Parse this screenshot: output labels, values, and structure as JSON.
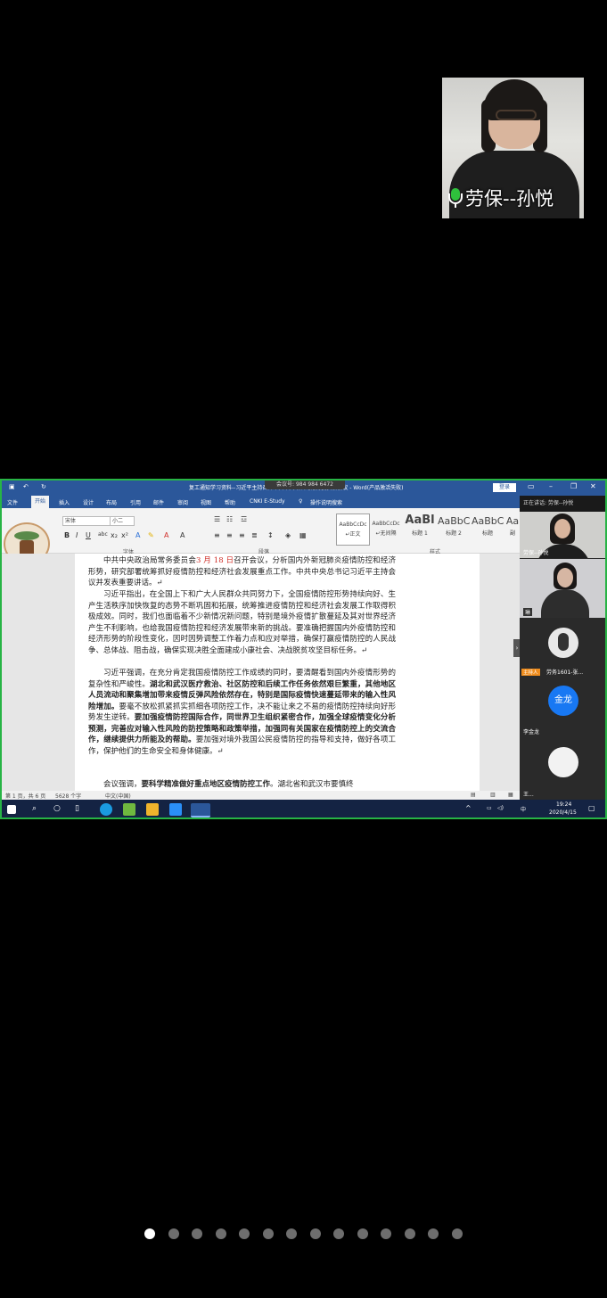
{
  "presenter": {
    "name": "劳保--孙悦"
  },
  "window": {
    "title": "复工通知学习资料--习近平主持召开中共中央政治局常务委员会会议 - Word(产品激活失败)",
    "meeting_code": "会议号: 984 984 6472",
    "login": "登录"
  },
  "ribbon": {
    "tabs": [
      "文件",
      "开始",
      "插入",
      "设计",
      "布局",
      "引用",
      "邮件",
      "审阅",
      "视图",
      "帮助",
      "CNKI E-Study",
      "操作说明搜索"
    ],
    "font_name": "宋体",
    "font_size": "小二",
    "groups": {
      "font": "字体",
      "paragraph": "段落",
      "styles": "样式"
    },
    "styles": [
      {
        "sample": "AaBbCcDc",
        "label": "↵正文"
      },
      {
        "sample": "AaBbCcDc",
        "label": "↵无间隔"
      },
      {
        "sample": "AaBl",
        "label": "标题 1"
      },
      {
        "sample": "AaBbC",
        "label": "标题 2"
      },
      {
        "sample": "AaBbC",
        "label": "标题"
      },
      {
        "sample": "Aa",
        "label": "副"
      }
    ]
  },
  "document": {
    "p1_a": "中共中央政治局常务委员会",
    "p1_date": "3 月 18 日",
    "p1_b": "召开会议，分析国内外新冠肺炎疫情防控和经济形势，研究部署统筹抓好疫情防控和经济社会发展重点工作。中共中央总书记习近平主持会议并发表重要讲话。↵",
    "p2": "习近平指出，在全国上下和广大人民群众共同努力下，全国疫情防控形势持续向好、生产生活秩序加快恢复的态势不断巩固和拓展，统筹推进疫情防控和经济社会发展工作取得积极成效。同时，我们也面临着不少新情况新问题，特别是境外疫情扩散蔓延及其对世界经济产生不利影响，也给我国疫情防控和经济发展带来新的挑战。要准确把握国内外疫情防控和经济形势的阶段性变化，因时因势调整工作着力点和应对举措，确保打赢疫情防控的人民战争、总体战、阻击战，确保实现决胜全面建成小康社会、决战脱贫攻坚目标任务。↵",
    "p3_a": "习近平强调，在充分肯定我国疫情防控工作成绩的同时，要清醒看到国内外疫情形势的复杂性和严峻性。",
    "p3_b": "湖北和武汉医疗救治、社区防控和后续工作任务依然艰巨繁重，其他地区人员流动和聚集增加带来疫情反弹风险依然存在，特别是国际疫情快速蔓延带来的输入性风险增加。",
    "p3_c": "要毫不放松抓紧抓实抓细各项防控工作，决不能让来之不易的疫情防控持续向好形势发生逆转。",
    "p3_d": "要加强疫情防控国际合作，同世界卫生组织紧密合作，加强全球疫情变化分析预测，完善应对输入性风险的防控策略和政策举措，加强同有关国家在疫情防控上的交流合作，继续提供力所能及的帮助。",
    "p3_e": "要加强对境外我国公民疫情防控的指导和支持，做好各项工作，保护他们的生命安全和身体健康。↵",
    "p4_a": "会议强调，",
    "p4_b": "要科学精准做好重点地区疫情防控工作",
    "p4_c": "。湖北省和武汉市要慎终"
  },
  "statusbar": {
    "page": "第 1 页，共 6 页",
    "words": "5628 个字",
    "lang": "中文(中国)"
  },
  "panel": {
    "header": "正在讲话: 劳保--孙悦",
    "tiles": [
      {
        "name": "劳保--孙悦"
      },
      {
        "name": "琳"
      },
      {
        "name": "劳务1601-张...",
        "tag": "主持人"
      },
      {
        "name": "李金龙",
        "avatar_text": "金龙"
      },
      {
        "name": "王..."
      }
    ]
  },
  "taskbar": {
    "time": "19:24",
    "date": "2020/4/15",
    "ime": "中"
  },
  "pagination": {
    "count": 14,
    "active": 1
  }
}
